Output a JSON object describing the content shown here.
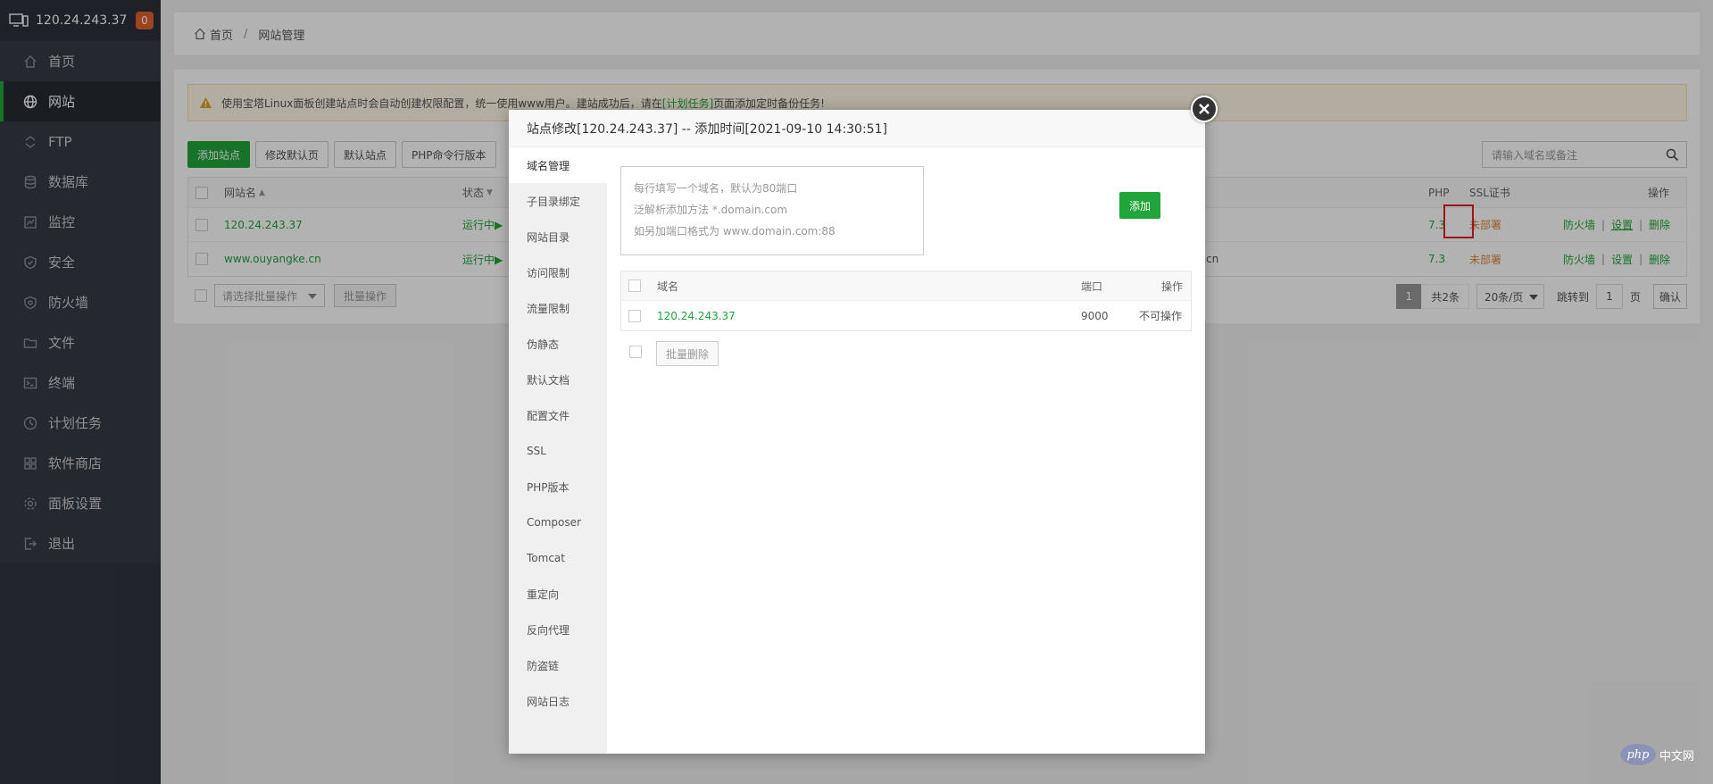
{
  "sidebar": {
    "server_ip": "120.24.243.37",
    "badge_count": "0",
    "items": [
      {
        "label": "首页",
        "icon": "home-icon"
      },
      {
        "label": "网站",
        "icon": "globe-icon",
        "active": true
      },
      {
        "label": "FTP",
        "icon": "ftp-icon"
      },
      {
        "label": "数据库",
        "icon": "database-icon"
      },
      {
        "label": "监控",
        "icon": "monitor-icon"
      },
      {
        "label": "安全",
        "icon": "shield-icon"
      },
      {
        "label": "防火墙",
        "icon": "firewall-icon"
      },
      {
        "label": "文件",
        "icon": "folder-icon"
      },
      {
        "label": "终端",
        "icon": "terminal-icon"
      },
      {
        "label": "计划任务",
        "icon": "clock-icon"
      },
      {
        "label": "软件商店",
        "icon": "grid-icon"
      },
      {
        "label": "面板设置",
        "icon": "gear-icon"
      },
      {
        "label": "退出",
        "icon": "logout-icon"
      }
    ]
  },
  "breadcrumb": {
    "home": "首页",
    "separator": "/",
    "current": "网站管理"
  },
  "notice": {
    "text_before": "使用宝塔Linux面板创建站点时会自动创建权限配置，统一使用www用户。建站成功后，请在",
    "link": "[计划任务]",
    "text_after": "页面添加定时备份任务!"
  },
  "toolbar": {
    "add_site": "添加站点",
    "edit_default": "修改默认页",
    "default_site": "默认站点",
    "php_cli": "PHP命令行版本"
  },
  "search": {
    "placeholder": "请输入域名或备注"
  },
  "sites_table": {
    "headers": {
      "name": "网站名",
      "status": "状态",
      "php": "PHP",
      "ssl": "SSL证书",
      "ops": "操作"
    },
    "rows": [
      {
        "name": "120.24.243.37",
        "status": "运行中▶",
        "remark_tail": "",
        "php": "7.3",
        "ssl": "未部署",
        "op_firewall": "防火墙",
        "op_settings": "设置",
        "op_delete": "删除"
      },
      {
        "name": "www.ouyangke.cn",
        "status": "运行中▶",
        "remark_tail": "cn",
        "php": "7.3",
        "ssl": "未部署",
        "op_firewall": "防火墙",
        "op_settings": "设置",
        "op_delete": "删除"
      }
    ],
    "separator": "|"
  },
  "bulk": {
    "select_placeholder": "请选择批量操作",
    "button": "批量操作"
  },
  "pager": {
    "current": "1",
    "total": "共2条",
    "page_size": "20条/页",
    "jump_label": "跳转到",
    "jump_value": "1",
    "page_unit": "页",
    "confirm": "确认"
  },
  "dialog": {
    "title": "站点修改[120.24.243.37] -- 添加时间[2021-09-10 14:30:51]",
    "nav": [
      "域名管理",
      "子目录绑定",
      "网站目录",
      "访问限制",
      "流量限制",
      "伪静态",
      "默认文档",
      "配置文件",
      "SSL",
      "PHP版本",
      "Composer",
      "Tomcat",
      "重定向",
      "反向代理",
      "防盗链",
      "网站日志"
    ],
    "textarea_hint": [
      "每行填写一个域名，默认为80端口",
      "泛解析添加方法 *.domain.com",
      "如另加端口格式为 www.domain.com:88"
    ],
    "add_button": "添加",
    "table": {
      "headers": {
        "domain": "域名",
        "port": "端口",
        "ops": "操作"
      },
      "rows": [
        {
          "domain": "120.24.243.37",
          "port": "9000",
          "ops": "不可操作"
        }
      ]
    },
    "bulk_delete": "批量删除"
  },
  "watermark": {
    "logo": "php",
    "text": "中文网"
  },
  "colors": {
    "accent": "#20a53a",
    "sidebar_bg": "#2f3640",
    "badge": "#e0612d",
    "ssl_warning": "#e0853c",
    "highlight": "#e02020"
  }
}
